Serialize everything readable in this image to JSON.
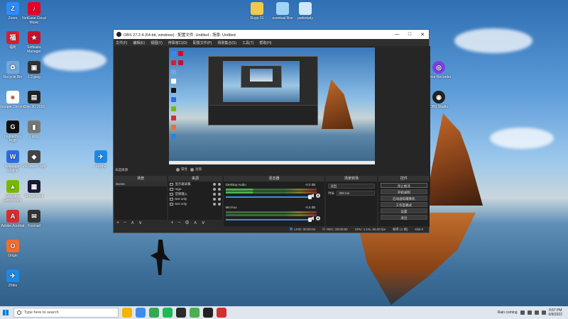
{
  "desktop_icons": [
    {
      "label": "Zoom",
      "color": "#2d8cff",
      "glyph": "Z"
    },
    {
      "label": "NetEase Cloud Music",
      "color": "#e60026",
      "glyph": "♪"
    },
    {
      "label": "福昕",
      "color": "#d91e2b",
      "glyph": "福"
    },
    {
      "label": "Software Manager",
      "color": "#c8102e",
      "glyph": "★"
    },
    {
      "label": "Recycle Bin",
      "color": "#6fa8dc",
      "glyph": "♻"
    },
    {
      "label": "1.2.jpeg",
      "color": "#333333",
      "glyph": "▣"
    },
    {
      "label": "Google Chrome",
      "color": "#ffffff",
      "glyph": "●"
    },
    {
      "label": "Chip 3D 2022",
      "color": "#222222",
      "glyph": "▤"
    },
    {
      "label": "Logitech G HUB",
      "color": "#111111",
      "glyph": "G"
    },
    {
      "label": "Ligzg",
      "color": "#777777",
      "glyph": "▮"
    },
    {
      "label": "Wallpaper Engine",
      "color": "#2d6cdf",
      "glyph": "W"
    },
    {
      "label": "PWSteam Sub",
      "color": "#444444",
      "glyph": "◆"
    },
    {
      "label": "GeForce Experience",
      "color": "#76b900",
      "glyph": "▲"
    },
    {
      "label": "Streamdeck",
      "color": "#1a1a3a",
      "glyph": "▦"
    },
    {
      "label": "Adobe Acrobat",
      "color": "#d32f2f",
      "glyph": "A"
    },
    {
      "label": "Foxmail",
      "color": "#333333",
      "glyph": "✉"
    },
    {
      "label": "Origin",
      "color": "#f56c2d",
      "glyph": "O"
    },
    {
      "label": "Feishu",
      "color": "#1e88e5",
      "glyph": "✈"
    },
    {
      "label": "Zhihu",
      "color": "#1e88e5",
      "glyph": "✈"
    }
  ],
  "desktop_icons_top": [
    {
      "label": "Rugo 01",
      "color": "#f2c94c"
    },
    {
      "label": "eventual Box",
      "color": "#9fd4f5"
    },
    {
      "label": "parkstudy",
      "color": "#cfe8f7"
    }
  ],
  "desktop_icons_right": [
    {
      "label": "Mirror Recorder",
      "color": "#7b3fe4",
      "glyph": "◎"
    },
    {
      "label": "OBS Studio",
      "color": "#222222",
      "glyph": "◉"
    }
  ],
  "obs": {
    "title": "OBS 27.2.4 (64-bit, windows) - 配置文件: Untitled - 场景: Untitled",
    "window_buttons": [
      "—",
      "□",
      "✕"
    ],
    "menu": [
      "文件(F)",
      "编辑(E)",
      "视图(V)",
      "停靠窗口(D)",
      "配置文件(P)",
      "场景集合(S)",
      "工具(T)",
      "帮助(H)"
    ],
    "scene_label": "未选择源",
    "mode_buttons": [
      "属性",
      "滤镜"
    ],
    "docks": {
      "scenes": {
        "title": "场景",
        "items": [
          "Scene"
        ],
        "footer": "+ − ∧ ∨"
      },
      "sources": {
        "title": "来源",
        "items": [
          "显示器采集",
          "rugo",
          "音频输入",
          "text only",
          "text only"
        ],
        "footer": "+ − ⚙ ∧ ∨"
      },
      "mixer": {
        "title": "混音器",
        "tracks": [
          {
            "name": "Desktop Audio",
            "db": "-0.0 dB"
          },
          {
            "name": "Mic/Aux",
            "db": "-0.0 dB"
          }
        ]
      },
      "transitions": {
        "title": "场景转场",
        "type": "淡出",
        "duration_label": "时长",
        "duration": "300 ms"
      },
      "controls": {
        "title": "控件",
        "buttons": [
          "停止推流",
          "开始录制",
          "启动虚拟摄像机",
          "工作室模式",
          "设置",
          "退出"
        ]
      }
    },
    "status": {
      "live": "LIVE: 00:00:04",
      "rec": "REC: 00:00:00",
      "cpu": "CPU: 1.1%, 60.00 fps",
      "extra1": "帧率 (1 帧)",
      "extra2": "Kbit 0"
    }
  },
  "taskbar": {
    "search_placeholder": "Type here to search",
    "weather": "Rain coming",
    "time": "9:57 PM",
    "date": "6/8/2022",
    "apps": [
      "#f4b400",
      "#3c8cf0",
      "#34a853",
      "#1db954",
      "#2b2b2b",
      "#4caf50",
      "#222222",
      "#d32f2f"
    ]
  }
}
